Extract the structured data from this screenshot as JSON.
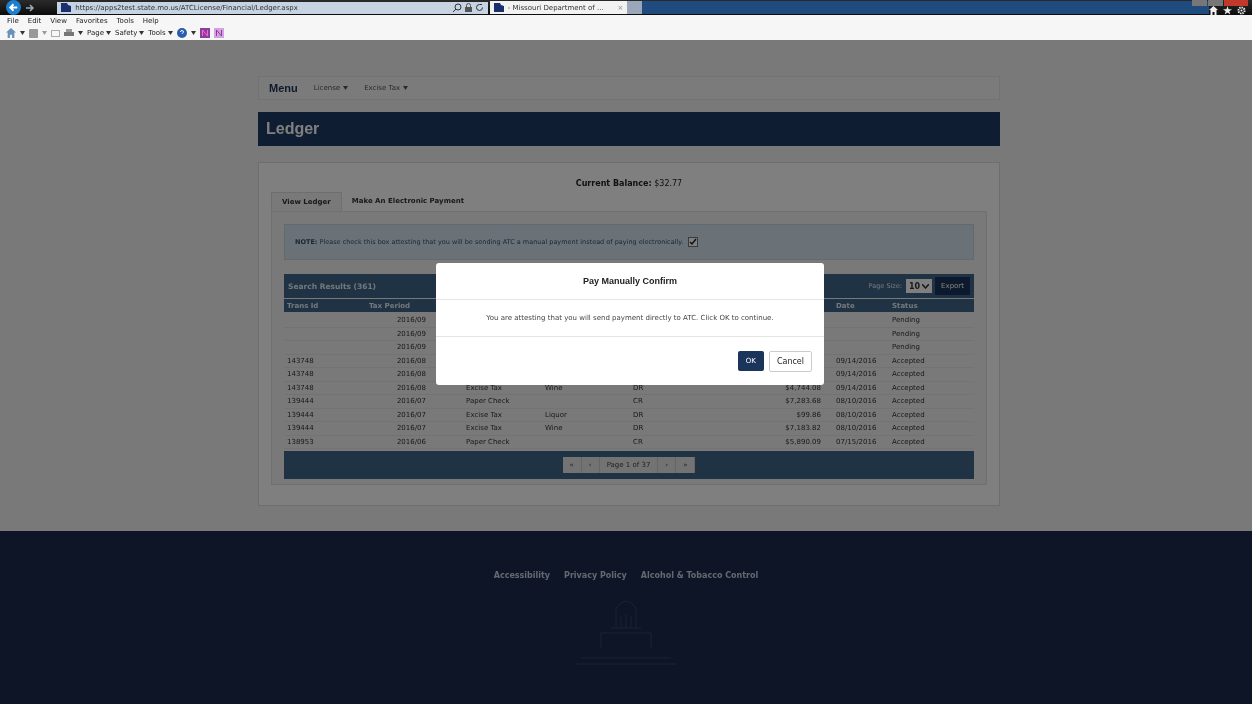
{
  "browser": {
    "url": "https://apps2test.state.mo.us/ATCLicense/Financial/Ledger.aspx",
    "tab_title": "- Missouri Department of ...",
    "tab_close": "×",
    "menu": [
      "File",
      "Edit",
      "View",
      "Favorites",
      "Tools",
      "Help"
    ],
    "commands": [
      "Page",
      "Safety",
      "Tools"
    ]
  },
  "nav": {
    "brand": "Menu",
    "items": [
      "License",
      "Excise Tax"
    ]
  },
  "page_title": "Ledger",
  "balance": {
    "label": "Current Balance:",
    "value": "$32.77"
  },
  "tabs": [
    {
      "label": "View Ledger",
      "selected": true
    },
    {
      "label": "Make An Electronic Payment",
      "selected": false
    }
  ],
  "note": {
    "label": "NOTE:",
    "text": "Please check this box attesting that you will be sending ATC a manual payment instead of paying electronically.",
    "checked": true
  },
  "results": {
    "title": "Search Results (361)",
    "page_size_label": "Page Size:",
    "page_size": "10",
    "export": "Export"
  },
  "table": {
    "columns": [
      "Trans Id",
      "Tax Period",
      null,
      null,
      null,
      null,
      "Date",
      "Status"
    ],
    "rows": [
      [
        "",
        "2016/09",
        null,
        null,
        null,
        null,
        "",
        "Pending"
      ],
      [
        "",
        "2016/09",
        null,
        null,
        null,
        null,
        "",
        "Pending"
      ],
      [
        "",
        "2016/09",
        null,
        null,
        null,
        null,
        "",
        "Pending"
      ],
      [
        "143748",
        "2016/08",
        null,
        null,
        null,
        null,
        "09/14/2016",
        "Accepted"
      ],
      [
        "143748",
        "2016/08",
        null,
        null,
        null,
        null,
        "09/14/2016",
        "Accepted"
      ],
      [
        "143748",
        "2016/08",
        "Excise Tax",
        "Wine",
        "DR",
        "$4,744.08",
        "09/14/2016",
        "Accepted"
      ],
      [
        "139444",
        "2016/07",
        "Paper Check",
        "",
        "CR",
        "$7,283.68",
        "08/10/2016",
        "Accepted"
      ],
      [
        "139444",
        "2016/07",
        "Excise Tax",
        "Liquor",
        "DR",
        "$99.86",
        "08/10/2016",
        "Accepted"
      ],
      [
        "139444",
        "2016/07",
        "Excise Tax",
        "Wine",
        "DR",
        "$7,183.82",
        "08/10/2016",
        "Accepted"
      ],
      [
        "138953",
        "2016/06",
        "Paper Check",
        "",
        "CR",
        "$5,890.09",
        "07/15/2016",
        "Accepted"
      ]
    ]
  },
  "pager": {
    "first": "«",
    "prev": "‹",
    "info": "Page 1 of 37",
    "next": "›",
    "last": "»"
  },
  "footer": {
    "links": [
      "Accessibility",
      "Privacy Policy",
      "Alcohol & Tobacco Control"
    ]
  },
  "modal": {
    "title": "Pay Manually Confirm",
    "body": "You are attesting that you will send payment directly to ATC. Click OK to continue.",
    "ok": "OK",
    "cancel": "Cancel"
  }
}
